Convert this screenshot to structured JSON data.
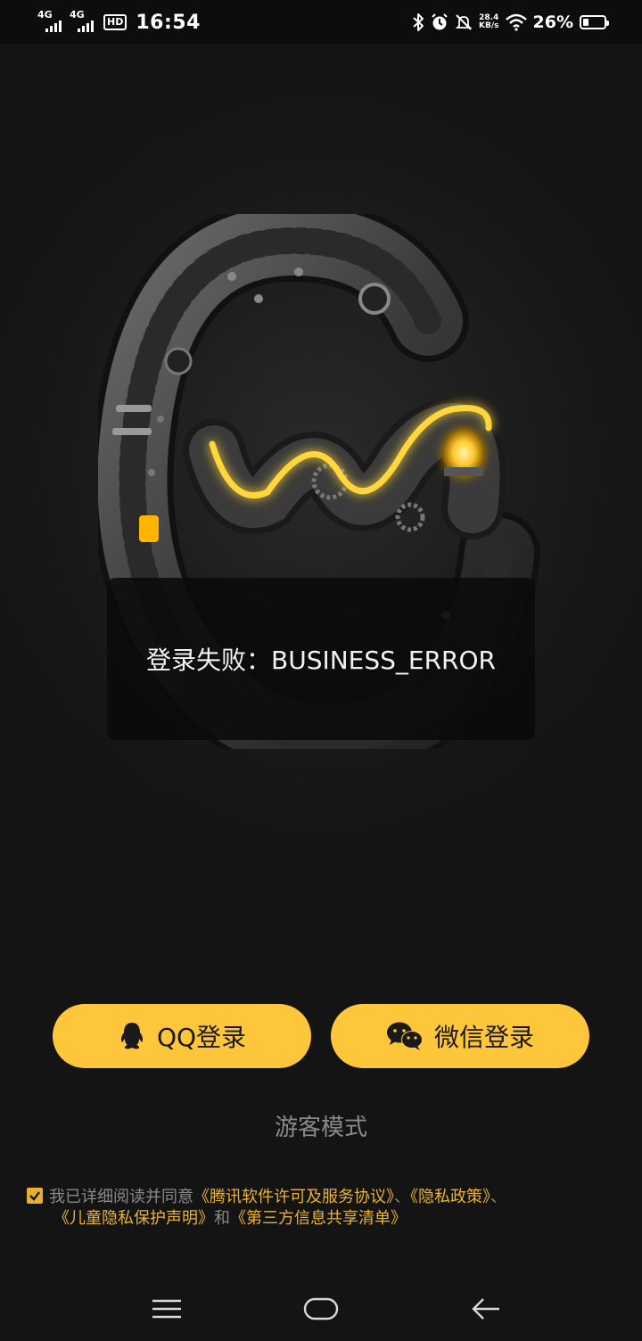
{
  "status_bar": {
    "net1": "4G",
    "net2": "4G",
    "hd": "HD",
    "time": "16:54",
    "speed_value": "28.4",
    "speed_unit": "KB/s",
    "battery_percent": "26%",
    "battery_level": 0.26
  },
  "toast": {
    "message": "登录失败：BUSINESS_ERROR"
  },
  "login": {
    "qq_label": "QQ登录",
    "wechat_label": "微信登录",
    "guest_label": "游客模式"
  },
  "agreement": {
    "checked": true,
    "prefix": "我已详细阅读并同意",
    "link_license": "《腾讯软件许可及服务协议》",
    "sep1": "、",
    "link_privacy": "《隐私政策》",
    "sep2": "、",
    "link_child": "《儿童隐私保护声明》",
    "and": "和",
    "link_thirdparty": "《第三方信息共享清单》"
  },
  "colors": {
    "accent": "#fec63a",
    "link": "#e9b431",
    "background": "#141414",
    "toast_bg": "#0a0a0a"
  },
  "icons": {
    "qq": "qq-penguin-icon",
    "wechat": "wechat-icon",
    "menu": "menu-icon",
    "home": "home-icon",
    "back": "back-arrow-icon"
  }
}
